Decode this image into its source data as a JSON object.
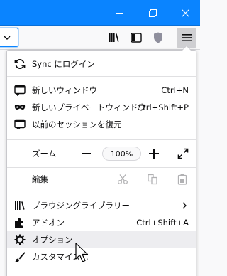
{
  "window": {
    "minimize_icon": "minimize-icon",
    "restore_icon": "restore-icon",
    "close_icon": "close-icon",
    "titlebar_color": "#0a84ff"
  },
  "toolbar": {
    "icons": [
      "chevron-down-icon",
      "library-icon",
      "sidebar-icon",
      "shield-icon",
      "hamburger-menu-icon"
    ]
  },
  "menu": {
    "sync": "Sync にログイン",
    "new_window": "新しいウィンドウ",
    "new_window_shortcut": "Ctrl+N",
    "new_private_window": "新しいプライベートウィンドウ",
    "new_private_window_shortcut": "Ctrl+Shift+P",
    "restore_session": "以前のセッションを復元",
    "zoom_label": "ズーム",
    "zoom_value": "100%",
    "edit_label": "編集",
    "library": "ブラウジングライブラリー",
    "addons": "アドオン",
    "addons_shortcut": "Ctrl+Shift+A",
    "options": "オプション",
    "customize": "カスタマイズ..."
  }
}
